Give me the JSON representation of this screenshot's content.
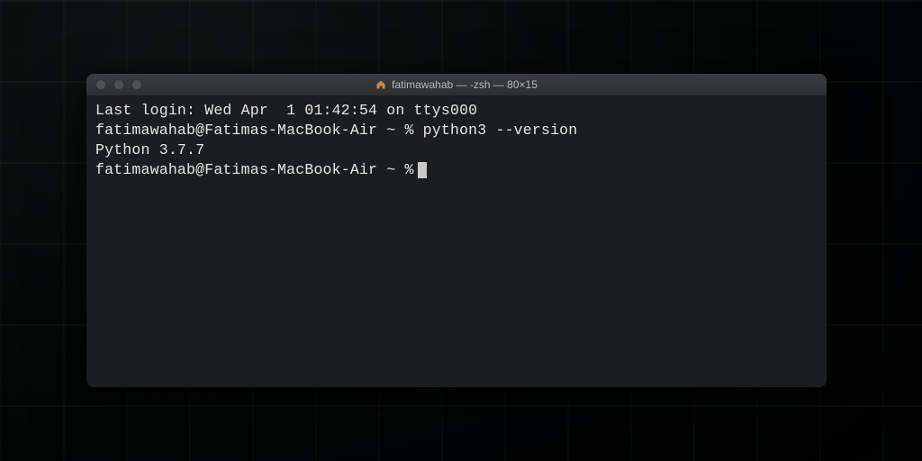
{
  "window": {
    "title": "fatimawahab — -zsh — 80×15"
  },
  "terminal": {
    "lines": {
      "last_login": "Last login: Wed Apr  1 01:42:54 on ttys000",
      "prompt1": "fatimawahab@Fatimas-MacBook-Air ~ % python3 --version",
      "output": "Python 3.7.7",
      "prompt2": "fatimawahab@Fatimas-MacBook-Air ~ %"
    }
  }
}
